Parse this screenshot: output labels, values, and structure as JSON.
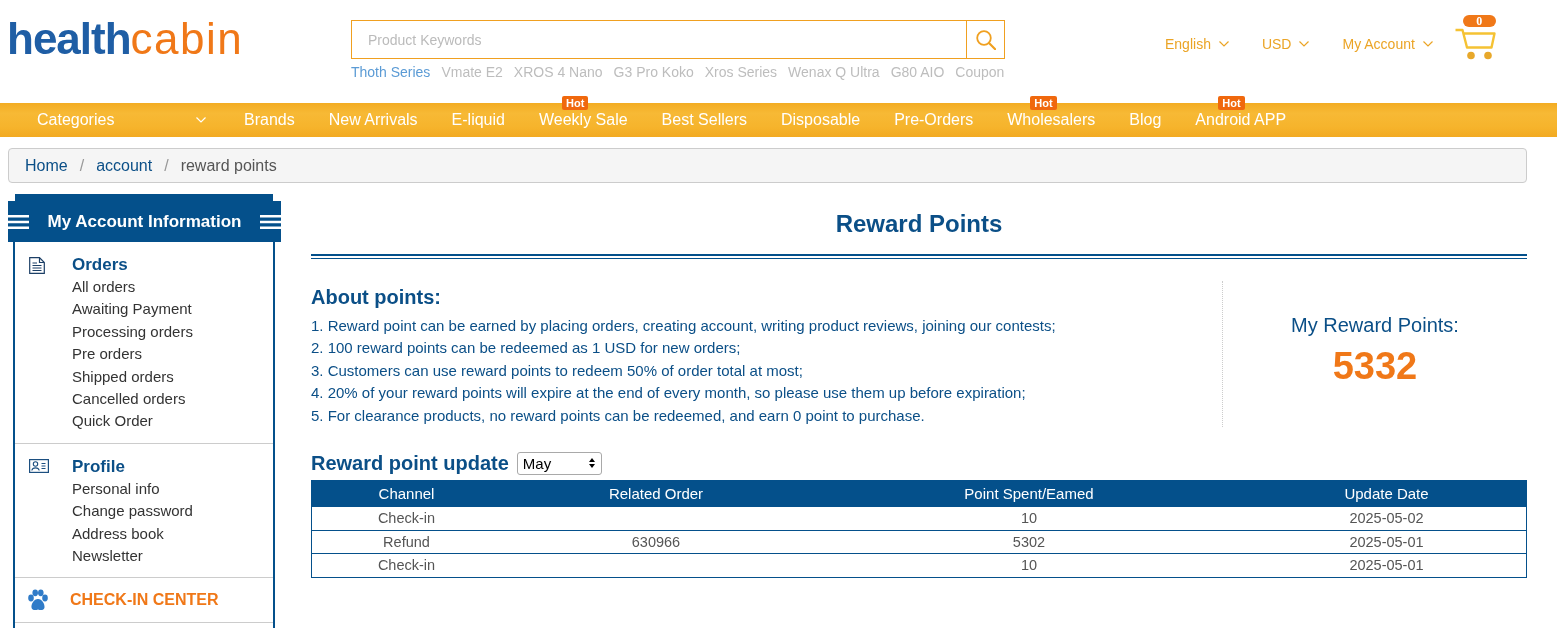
{
  "header": {
    "logo": {
      "part_1": "health",
      "part_2": "cabin"
    },
    "search": {
      "placeholder": "Product Keywords"
    },
    "hot_keywords": [
      {
        "label": "Thoth Series",
        "highlighted": true
      },
      {
        "label": "Vmate E2",
        "highlighted": false
      },
      {
        "label": "XROS 4 Nano",
        "highlighted": false
      },
      {
        "label": "G3 Pro Koko",
        "highlighted": false
      },
      {
        "label": "Xros Series",
        "highlighted": false
      },
      {
        "label": "Wenax Q Ultra",
        "highlighted": false
      },
      {
        "label": "G80 AIO",
        "highlighted": false
      },
      {
        "label": "Coupon",
        "highlighted": false
      }
    ],
    "menus": [
      {
        "label": "English"
      },
      {
        "label": "USD"
      },
      {
        "label": "My Account"
      }
    ],
    "cart": {
      "count": "0"
    }
  },
  "nav": {
    "categories": {
      "label": "Categories"
    },
    "items": [
      {
        "label": "Brands"
      },
      {
        "label": "New Arrivals"
      },
      {
        "label": "E-liquid"
      },
      {
        "label": "Weekly Sale",
        "badge": "Hot"
      },
      {
        "label": "Best Sellers"
      },
      {
        "label": "Disposable"
      },
      {
        "label": "Pre-Orders"
      },
      {
        "label": "Wholesalers",
        "badge": "Hot"
      },
      {
        "label": "Blog"
      },
      {
        "label": "Android APP",
        "badge": "Hot"
      }
    ]
  },
  "breadcrumb": {
    "items": [
      {
        "label": "Home",
        "current": false
      },
      {
        "label": "account",
        "current": false
      },
      {
        "label": "reward points",
        "current": true
      }
    ],
    "separators": [
      "/",
      "/"
    ]
  },
  "sidebar": {
    "title": "My Account Information",
    "sections": [
      {
        "kind": "group",
        "title": "Orders",
        "items": [
          "All orders",
          "Awaiting Payment",
          "Processing orders",
          "Pre orders",
          "Shipped orders",
          "Cancelled orders",
          "Quick Order"
        ]
      },
      {
        "kind": "group",
        "title": "Profile",
        "items": [
          "Personal info",
          "Change password",
          "Address book",
          "Newsletter"
        ]
      },
      {
        "kind": "link",
        "title": "CHECK-IN CENTER"
      }
    ]
  },
  "main": {
    "title": "Reward Points",
    "about": {
      "heading": "About points:",
      "rules": [
        "1. Reward point can be earned by placing orders, creating account, writing product reviews, joining our contests;",
        "2. 100 reward points can be redeemed as 1 USD for new orders;",
        "3. Customers can use reward points to redeem 50% of order total at most;",
        "4. 20% of your reward points will expire at the end of every month, so please use them up before expiration;",
        "5. For clearance products, no reward points can be redeemed, and earn 0 point to purchase."
      ]
    },
    "balance": {
      "label": "My Reward Points:",
      "value": "5332"
    },
    "history": {
      "heading": "Reward point update",
      "month": {
        "value": "May"
      },
      "table": {
        "columns": [
          "Channel",
          "Related Order",
          "Point Spent/Eamed",
          "Update Date"
        ],
        "rows": [
          {
            "channel": "Check-in",
            "points": "10",
            "date": "2025-05-02"
          },
          {
            "channel": "Refund",
            "related_order": "630966",
            "points": "5302",
            "date": "2025-05-01"
          },
          {
            "channel": "Check-in",
            "points": "10",
            "date": "2025-05-01"
          }
        ]
      }
    }
  }
}
